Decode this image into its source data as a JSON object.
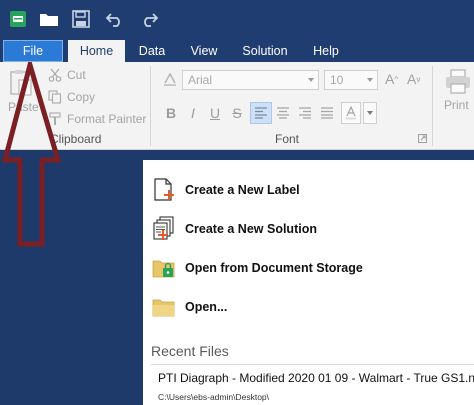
{
  "quick_access": {
    "icons": [
      "app-logo-icon",
      "open-folder-icon",
      "save-icon",
      "undo-icon",
      "redo-icon"
    ]
  },
  "tabs": [
    {
      "label": "File",
      "active": false
    },
    {
      "label": "Home",
      "active": true
    },
    {
      "label": "Data",
      "active": false
    },
    {
      "label": "View",
      "active": false
    },
    {
      "label": "Solution",
      "active": false
    },
    {
      "label": "Help",
      "active": false
    }
  ],
  "ribbon": {
    "clipboard": {
      "paste": "Paste",
      "cut": "Cut",
      "copy": "Copy",
      "format_painter": "Format Painter",
      "group_label": "Clipboard"
    },
    "font": {
      "font_name": "Arial",
      "font_size": "10",
      "buttons": [
        "B",
        "I",
        "U",
        "S"
      ],
      "group_label": "Font"
    },
    "print": "Print"
  },
  "backstage": {
    "commands": [
      {
        "label": "Create a New Label",
        "icon": "new-label-icon"
      },
      {
        "label": "Create a New Solution",
        "icon": "new-solution-icon"
      },
      {
        "label": "Open from Document Storage",
        "icon": "document-storage-icon"
      },
      {
        "label": "Open...",
        "icon": "open-folder-icon"
      }
    ],
    "recent_files_title": "Recent Files",
    "recent_files": [
      {
        "name": "PTI Diagraph - Modified 2020 01 09 - Walmart - True GS1.n",
        "path": "C:\\Users\\ebs-admin\\Desktop\\"
      }
    ]
  },
  "colors": {
    "title_bar": "#1f3d70",
    "file_tab": "#2b7bd6",
    "ribbon": "#f3f3f3",
    "annotation_arrow": "#7a1f24"
  }
}
